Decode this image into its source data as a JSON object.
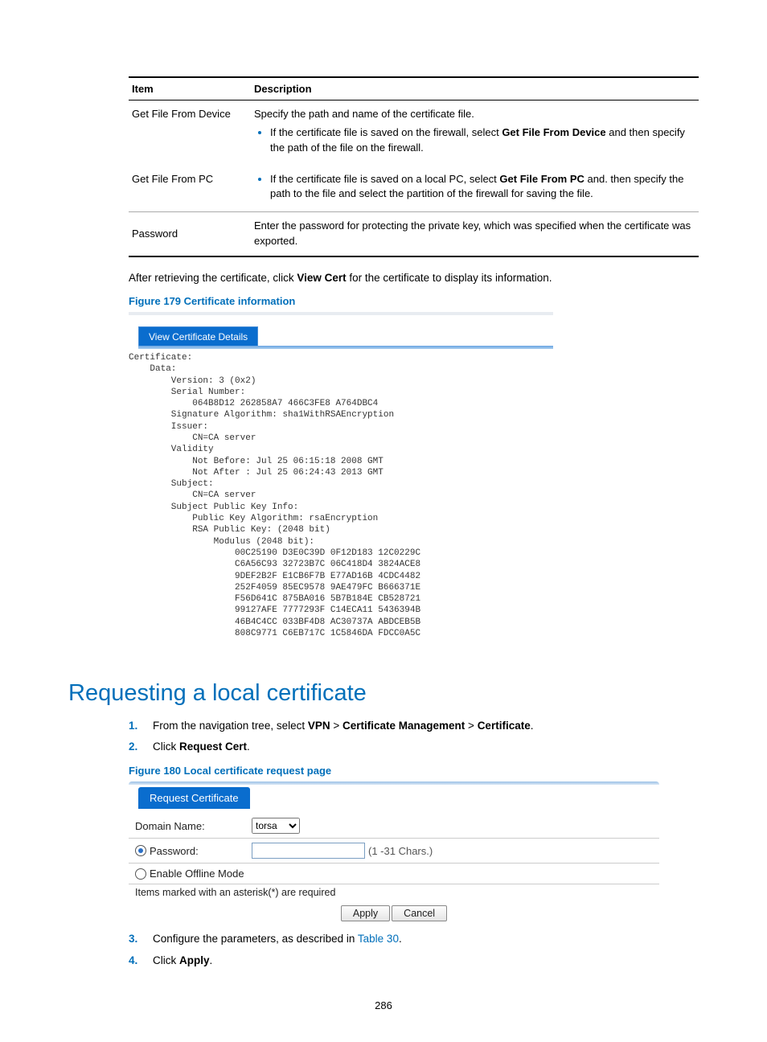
{
  "table": {
    "head_item": "Item",
    "head_desc": "Description",
    "row1_item": "Get File From Device",
    "row1_desc_intro": "Specify the path and name of the certificate file.",
    "row1_bullet_a": "If the certificate file is saved on the firewall, select ",
    "row1_bullet_a_bold": "Get File From Device",
    "row1_bullet_a_tail": " and then specify the path of the file on the firewall.",
    "row2_item": "Get File From PC",
    "row2_bullet_a": "If the certificate file is saved on a local PC, select ",
    "row2_bullet_a_bold": "Get File From PC",
    "row2_bullet_a_tail": " and. then specify the path to the file and select the partition of the firewall for saving the file.",
    "row3_item": "Password",
    "row3_desc": "Enter the password for protecting the private key, which was specified when the certificate was exported."
  },
  "after_text_a": "After retrieving the certificate, click ",
  "after_text_bold": "View Cert",
  "after_text_b": " for the certificate to display its information.",
  "fig179": "Figure 179 Certificate information",
  "cert_tab": "View Certificate Details",
  "cert_body": "Certificate:\n    Data:\n        Version: 3 (0x2)\n        Serial Number:\n            064B8D12 262858A7 466C3FE8 A764DBC4\n        Signature Algorithm: sha1WithRSAEncryption\n        Issuer:\n            CN=CA server\n        Validity\n            Not Before: Jul 25 06:15:18 2008 GMT\n            Not After : Jul 25 06:24:43 2013 GMT\n        Subject:\n            CN=CA server\n        Subject Public Key Info:\n            Public Key Algorithm: rsaEncryption\n            RSA Public Key: (2048 bit)\n                Modulus (2048 bit):\n                    00C25190 D3E0C39D 0F12D183 12C0229C\n                    C6A56C93 32723B7C 06C418D4 3824ACE8\n                    9DEF2B2F E1CB6F7B E77AD16B 4CDC4482\n                    252F4059 85EC9578 9AE479FC B666371E\n                    F56D641C 875BA016 5B7B184E CB528721\n                    99127AFE 7777293F C14ECA11 5436394B\n                    46B4C4CC 033BF4D8 AC30737A ABDCEB5B\n                    808C9771 C6EB717C 1C5846DA FDCC0A5C",
  "section_title": "Requesting a local certificate",
  "steps": {
    "s1_a": "From the navigation tree, select ",
    "s1_b1": "VPN",
    "s1_gt": " > ",
    "s1_b2": "Certificate Management",
    "s1_b3": "Certificate",
    "s2_a": "Click ",
    "s2_b": "Request Cert",
    "s3_a": "Configure the parameters, as described in ",
    "s3_link": "Table 30",
    "s4_a": "Click ",
    "s4_b": "Apply"
  },
  "fig180": "Figure 180 Local certificate request page",
  "ss2": {
    "tab": "Request Certificate",
    "domain_label": "Domain Name:",
    "domain_value": "torsa",
    "password_label": "Password:",
    "chars_hint": "(1 -31 Chars.)",
    "offline_label": "Enable Offline Mode",
    "note": "Items marked with an asterisk(*) are required",
    "apply": "Apply",
    "cancel": "Cancel"
  },
  "page_number": "286"
}
